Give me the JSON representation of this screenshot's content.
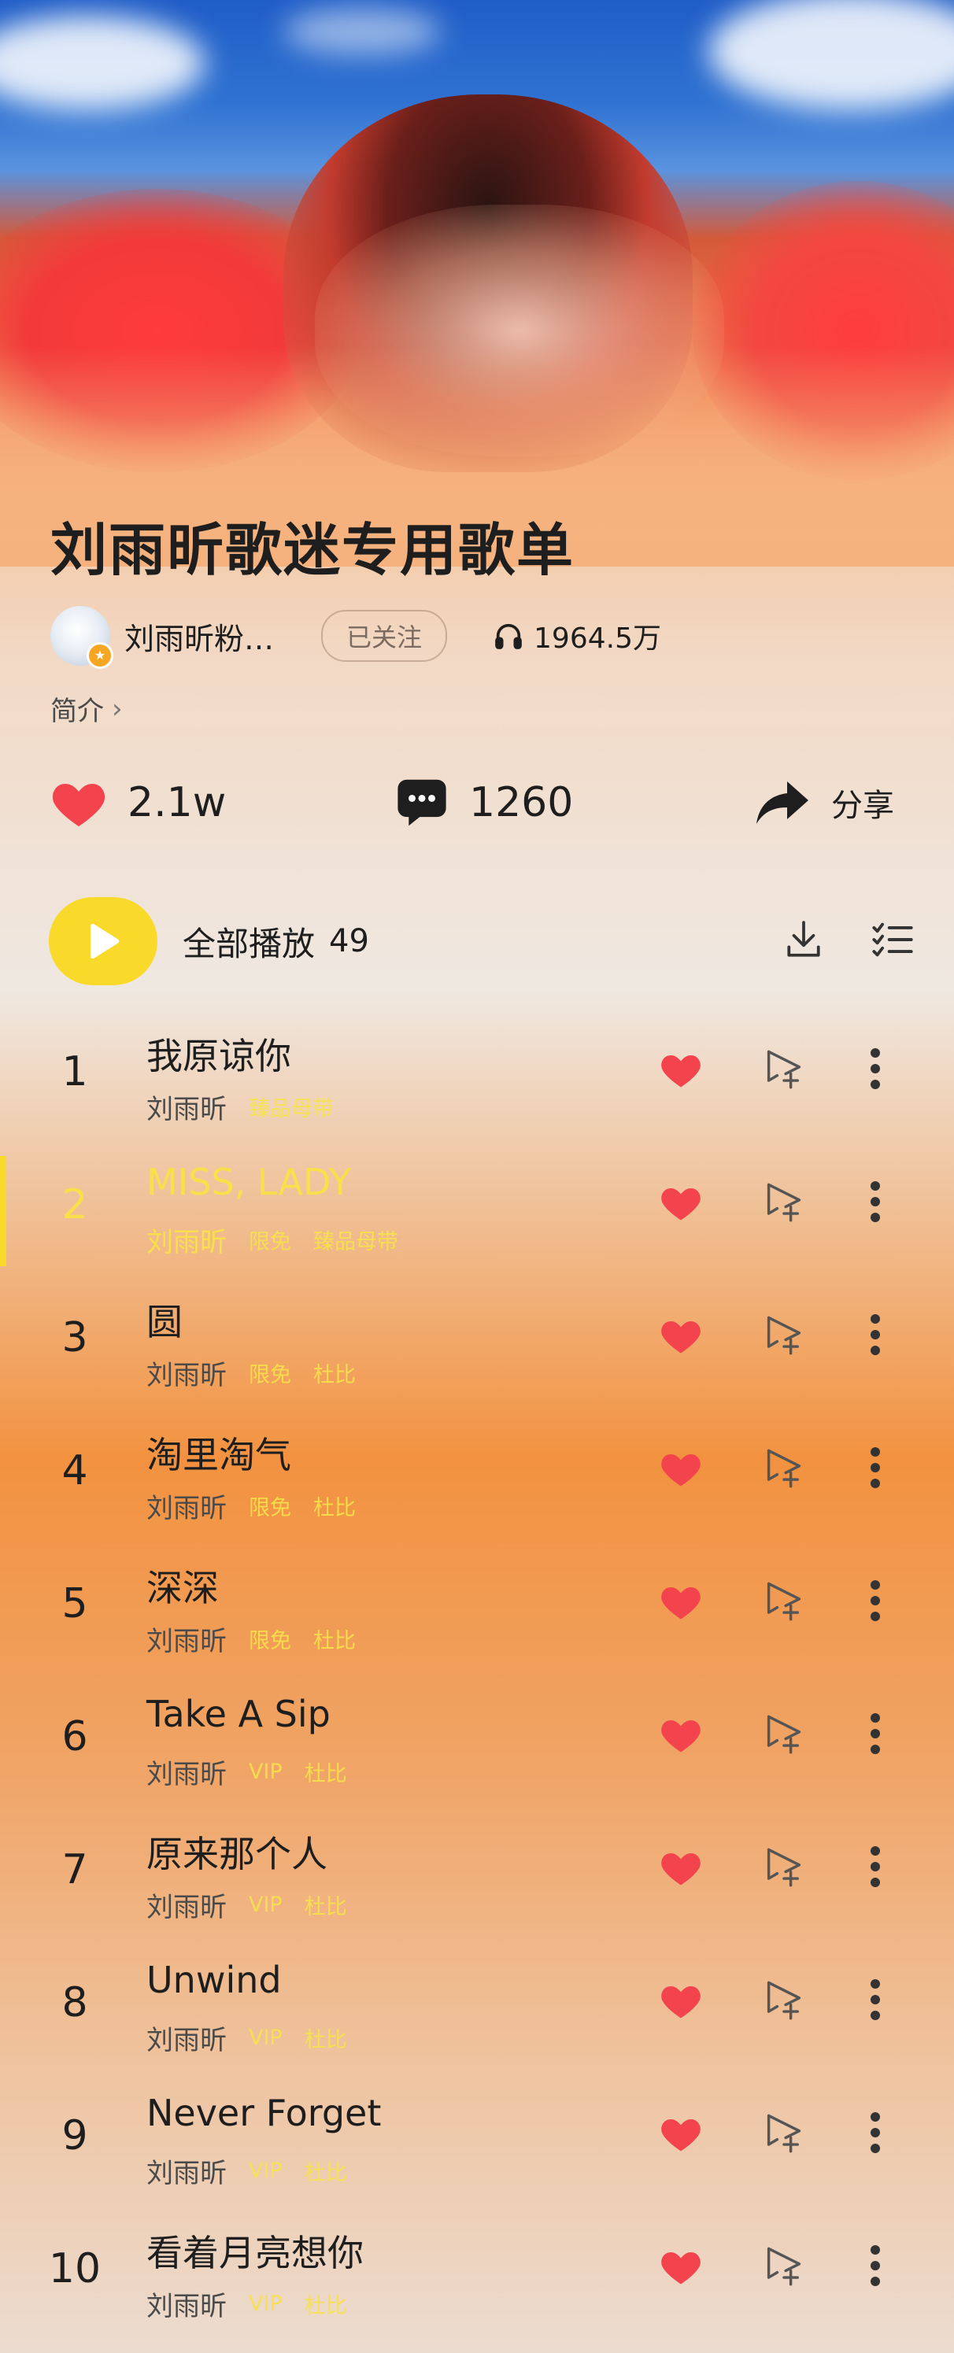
{
  "playlist": {
    "title": "刘雨昕歌迷专用歌单",
    "author": "刘雨昕粉…",
    "follow_label": "已关注",
    "play_count": "1964.5万",
    "intro_label": "简介",
    "intro_chevron": "›"
  },
  "stats": {
    "likes": "2.1w",
    "comments": "1260",
    "share_label": "分享"
  },
  "play_all": {
    "label": "全部播放",
    "count": "49"
  },
  "icons": {
    "like": "heart-icon",
    "comment": "comment-icon",
    "share": "share-arrow-icon",
    "download": "download-icon",
    "multi_select": "checklist-icon",
    "play": "play-icon",
    "add_to_playlist": "add-to-playlist-icon",
    "more": "more-vertical-icon",
    "listen": "headphones-icon"
  },
  "colors": {
    "accent_yellow": "#f9da2b",
    "heart_red": "#f3444e",
    "vip_tag": "#f7e34a"
  },
  "songs": [
    {
      "num": "1",
      "title": "我原谅你",
      "artist": "刘雨昕",
      "tags": [
        "臻品母带"
      ],
      "active": false
    },
    {
      "num": "2",
      "title": "MISS, LADY",
      "artist": "刘雨昕",
      "tags": [
        "限免",
        "臻品母带"
      ],
      "active": true
    },
    {
      "num": "3",
      "title": "圆",
      "artist": "刘雨昕",
      "tags": [
        "限免",
        "杜比"
      ],
      "active": false
    },
    {
      "num": "4",
      "title": "淘里淘气",
      "artist": "刘雨昕",
      "tags": [
        "限免",
        "杜比"
      ],
      "active": false
    },
    {
      "num": "5",
      "title": "深深",
      "artist": "刘雨昕",
      "tags": [
        "限免",
        "杜比"
      ],
      "active": false
    },
    {
      "num": "6",
      "title": "Take A Sip",
      "artist": "刘雨昕",
      "tags": [
        "VIP",
        "杜比"
      ],
      "active": false
    },
    {
      "num": "7",
      "title": "原来那个人",
      "artist": "刘雨昕",
      "tags": [
        "VIP",
        "杜比"
      ],
      "active": false
    },
    {
      "num": "8",
      "title": "Unwind",
      "artist": "刘雨昕",
      "tags": [
        "VIP",
        "杜比"
      ],
      "active": false
    },
    {
      "num": "9",
      "title": "Never Forget",
      "artist": "刘雨昕",
      "tags": [
        "VIP",
        "杜比"
      ],
      "active": false
    },
    {
      "num": "10",
      "title": "看着月亮想你",
      "artist": "刘雨昕",
      "tags": [
        "VIP",
        "杜比"
      ],
      "active": false
    }
  ]
}
